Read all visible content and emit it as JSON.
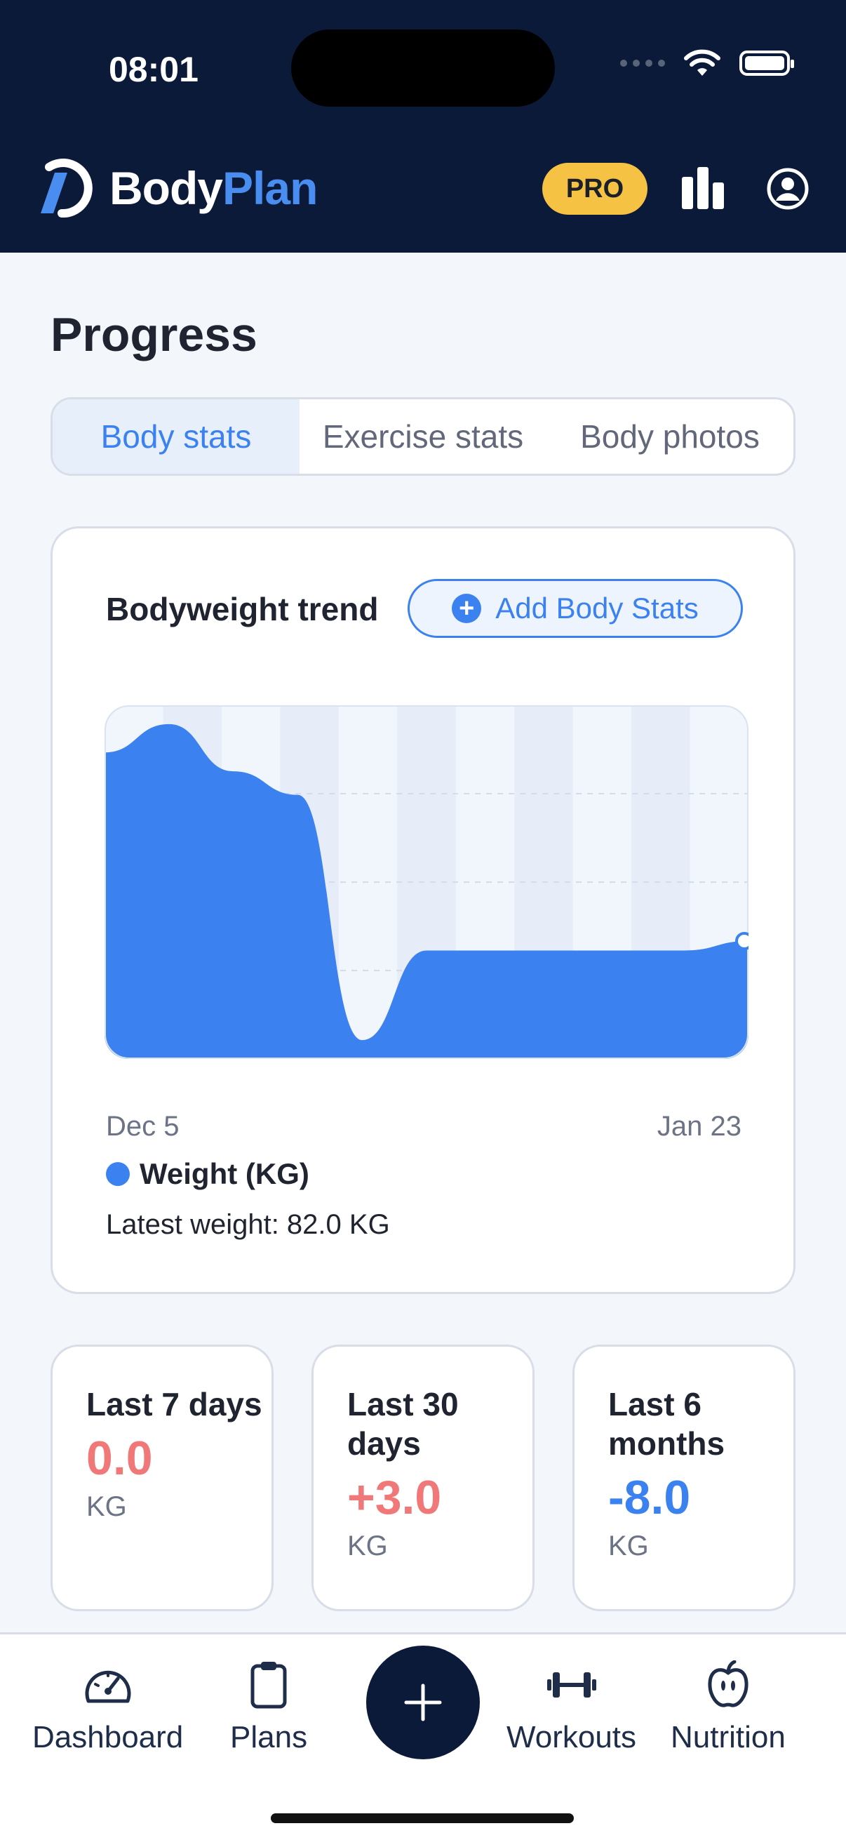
{
  "status_bar": {
    "time": "08:01"
  },
  "header": {
    "logo_part1": "Body",
    "logo_part2": "Plan",
    "pro_badge": "PRO",
    "icons": [
      "bar-chart-icon",
      "profile-icon"
    ]
  },
  "page": {
    "title": "Progress"
  },
  "tabs": [
    {
      "label": "Body stats",
      "active": true
    },
    {
      "label": "Exercise stats",
      "active": false
    },
    {
      "label": "Body photos",
      "active": false
    }
  ],
  "trend_card": {
    "title": "Bodyweight trend",
    "add_button": "Add Body Stats",
    "x_start_label": "Dec 5",
    "x_end_label": "Jan 23",
    "legend": "Weight (KG)",
    "latest": "Latest weight: 82.0 KG",
    "fill_color": "#3b82f0"
  },
  "chart_data": {
    "type": "area",
    "series": [
      {
        "name": "Weight (KG)",
        "values": [
          90,
          91.2,
          89.2,
          88.2,
          77.8,
          81.6,
          81.6,
          81.6,
          81.6,
          81.6,
          82.0
        ]
      }
    ],
    "x_labels": [
      "Dec 5",
      "Jan 23"
    ],
    "latest_value": 82.0,
    "unit": "KG",
    "grid": true
  },
  "summary": [
    {
      "label": "Last 7 days",
      "value": "0.0",
      "unit": "KG",
      "tone": "red"
    },
    {
      "label": "Last 30 days",
      "value": "+3.0",
      "unit": "KG",
      "tone": "red"
    },
    {
      "label": "Last 6 months",
      "value": "-8.0",
      "unit": "KG",
      "tone": "blue"
    }
  ],
  "nav": {
    "dashboard": "Dashboard",
    "plans": "Plans",
    "workouts": "Workouts",
    "nutrition": "Nutrition",
    "fab_icon": "plus-icon"
  }
}
